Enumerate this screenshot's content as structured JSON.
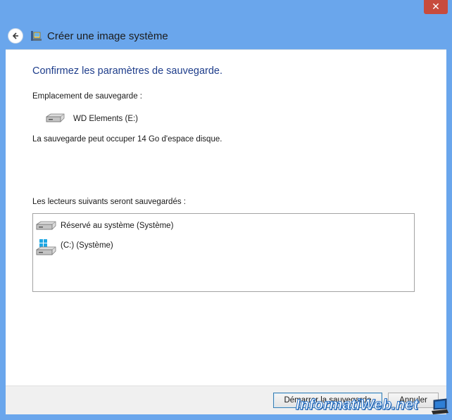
{
  "window": {
    "title": "Créer une image système",
    "close_glyph": "✕"
  },
  "main": {
    "heading": "Confirmez les paramètres de sauvegarde.",
    "location_label": "Emplacement de sauvegarde :",
    "location_drive": "WD Elements (E:)",
    "space_text": "La sauvegarde peut occuper 14 Go d'espace disque.",
    "drives_label": "Les lecteurs suivants seront sauvegardés :",
    "drives": [
      {
        "label": "Réservé au système (Système)",
        "icon": "hard-drive-icon"
      },
      {
        "label": "(C:) (Système)",
        "icon": "windows-drive-icon"
      }
    ]
  },
  "footer": {
    "start_button": "Démarrer la sauvegarde",
    "cancel_button": "Annuler"
  },
  "watermark": {
    "text": "InformatiWeb.net"
  },
  "colors": {
    "window_frame": "#6aa6ec",
    "heading": "#1e3d8b",
    "close_button": "#c74b3d",
    "windows_logo": "#1ea7e4"
  }
}
